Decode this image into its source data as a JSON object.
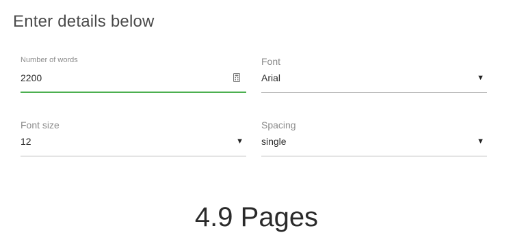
{
  "heading": "Enter details below",
  "fields": {
    "words": {
      "label": "Number of words",
      "value": "2200"
    },
    "font": {
      "label": "Font",
      "value": "Arial"
    },
    "size": {
      "label": "Font size",
      "value": "12"
    },
    "spacing": {
      "label": "Spacing",
      "value": "single"
    }
  },
  "icons": {
    "dropdown": "triangle-down-icon",
    "calculator": "calculator-icon"
  },
  "colors": {
    "active_underline": "#4caf50",
    "inactive_underline": "#b9b9b9"
  },
  "result": "4.9 Pages"
}
